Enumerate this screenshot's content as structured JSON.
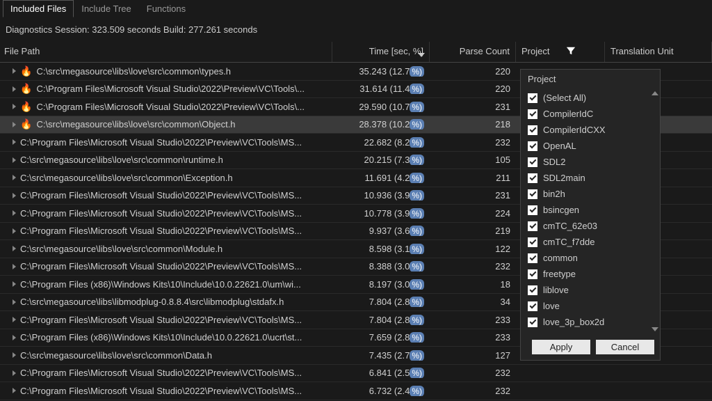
{
  "tabs": [
    "Included Files",
    "Include Tree",
    "Functions"
  ],
  "active_tab": 0,
  "status": "Diagnostics Session: 323.509 seconds  Build: 277.261 seconds",
  "columns": {
    "path": "File Path",
    "time": "Time [sec, %]",
    "parse": "Parse Count",
    "project": "Project",
    "unit": "Translation Unit"
  },
  "rows": [
    {
      "hot": true,
      "path": "C:\\src\\megasource\\libs\\love\\src\\common\\types.h",
      "time": "35.243 (12.7",
      "pct": "%)",
      "parse": "220",
      "hi": false
    },
    {
      "hot": true,
      "path": "C:\\Program Files\\Microsoft Visual Studio\\2022\\Preview\\VC\\Tools\\...",
      "time": "31.614 (11.4",
      "pct": "%)",
      "parse": "220",
      "hi": false
    },
    {
      "hot": true,
      "path": "C:\\Program Files\\Microsoft Visual Studio\\2022\\Preview\\VC\\Tools\\...",
      "time": "29.590 (10.7",
      "pct": "%)",
      "parse": "231",
      "hi": false
    },
    {
      "hot": true,
      "path": "C:\\src\\megasource\\libs\\love\\src\\common\\Object.h",
      "time": "28.378 (10.2",
      "pct": "%)",
      "parse": "218",
      "hi": true
    },
    {
      "hot": false,
      "path": "C:\\Program Files\\Microsoft Visual Studio\\2022\\Preview\\VC\\Tools\\MS...",
      "time": "22.682 (8.2",
      "pct": "%)",
      "parse": "232",
      "hi": false
    },
    {
      "hot": false,
      "path": "C:\\src\\megasource\\libs\\love\\src\\common\\runtime.h",
      "time": "20.215 (7.3",
      "pct": "%)",
      "parse": "105",
      "hi": false
    },
    {
      "hot": false,
      "path": "C:\\src\\megasource\\libs\\love\\src\\common\\Exception.h",
      "time": "11.691 (4.2",
      "pct": "%)",
      "parse": "211",
      "hi": false
    },
    {
      "hot": false,
      "path": "C:\\Program Files\\Microsoft Visual Studio\\2022\\Preview\\VC\\Tools\\MS...",
      "time": "10.936 (3.9",
      "pct": "%)",
      "parse": "231",
      "hi": false
    },
    {
      "hot": false,
      "path": "C:\\Program Files\\Microsoft Visual Studio\\2022\\Preview\\VC\\Tools\\MS...",
      "time": "10.778 (3.9",
      "pct": "%)",
      "parse": "224",
      "hi": false
    },
    {
      "hot": false,
      "path": "C:\\Program Files\\Microsoft Visual Studio\\2022\\Preview\\VC\\Tools\\MS...",
      "time": "9.937 (3.6",
      "pct": "%)",
      "parse": "219",
      "hi": false
    },
    {
      "hot": false,
      "path": "C:\\src\\megasource\\libs\\love\\src\\common\\Module.h",
      "time": "8.598 (3.1",
      "pct": "%)",
      "parse": "122",
      "hi": false
    },
    {
      "hot": false,
      "path": "C:\\Program Files\\Microsoft Visual Studio\\2022\\Preview\\VC\\Tools\\MS...",
      "time": "8.388 (3.0",
      "pct": "%)",
      "parse": "232",
      "hi": false
    },
    {
      "hot": false,
      "path": "C:\\Program Files (x86)\\Windows Kits\\10\\Include\\10.0.22621.0\\um\\wi...",
      "time": "8.197 (3.0",
      "pct": "%)",
      "parse": "18",
      "hi": false
    },
    {
      "hot": false,
      "path": "C:\\src\\megasource\\libs\\libmodplug-0.8.8.4\\src\\libmodplug\\stdafx.h",
      "time": "7.804 (2.8",
      "pct": "%)",
      "parse": "34",
      "hi": false
    },
    {
      "hot": false,
      "path": "C:\\Program Files\\Microsoft Visual Studio\\2022\\Preview\\VC\\Tools\\MS...",
      "time": "7.804 (2.8",
      "pct": "%)",
      "parse": "233",
      "hi": false
    },
    {
      "hot": false,
      "path": "C:\\Program Files (x86)\\Windows Kits\\10\\Include\\10.0.22621.0\\ucrt\\st...",
      "time": "7.659 (2.8",
      "pct": "%)",
      "parse": "233",
      "hi": false
    },
    {
      "hot": false,
      "path": "C:\\src\\megasource\\libs\\love\\src\\common\\Data.h",
      "time": "7.435 (2.7",
      "pct": "%)",
      "parse": "127",
      "hi": false
    },
    {
      "hot": false,
      "path": "C:\\Program Files\\Microsoft Visual Studio\\2022\\Preview\\VC\\Tools\\MS...",
      "time": "6.841 (2.5",
      "pct": "%)",
      "parse": "232",
      "hi": false
    },
    {
      "hot": false,
      "path": "C:\\Program Files\\Microsoft Visual Studio\\2022\\Preview\\VC\\Tools\\MS...",
      "time": "6.732 (2.4",
      "pct": "%)",
      "parse": "232",
      "hi": false
    }
  ],
  "filter": {
    "title": "Project",
    "items": [
      "(Select All)",
      "CompilerIdC",
      "CompilerIdCXX",
      "OpenAL",
      "SDL2",
      "SDL2main",
      "bin2h",
      "bsincgen",
      "cmTC_62e03",
      "cmTC_f7dde",
      "common",
      "freetype",
      "liblove",
      "love",
      "love_3p_box2d"
    ],
    "apply": "Apply",
    "cancel": "Cancel"
  }
}
